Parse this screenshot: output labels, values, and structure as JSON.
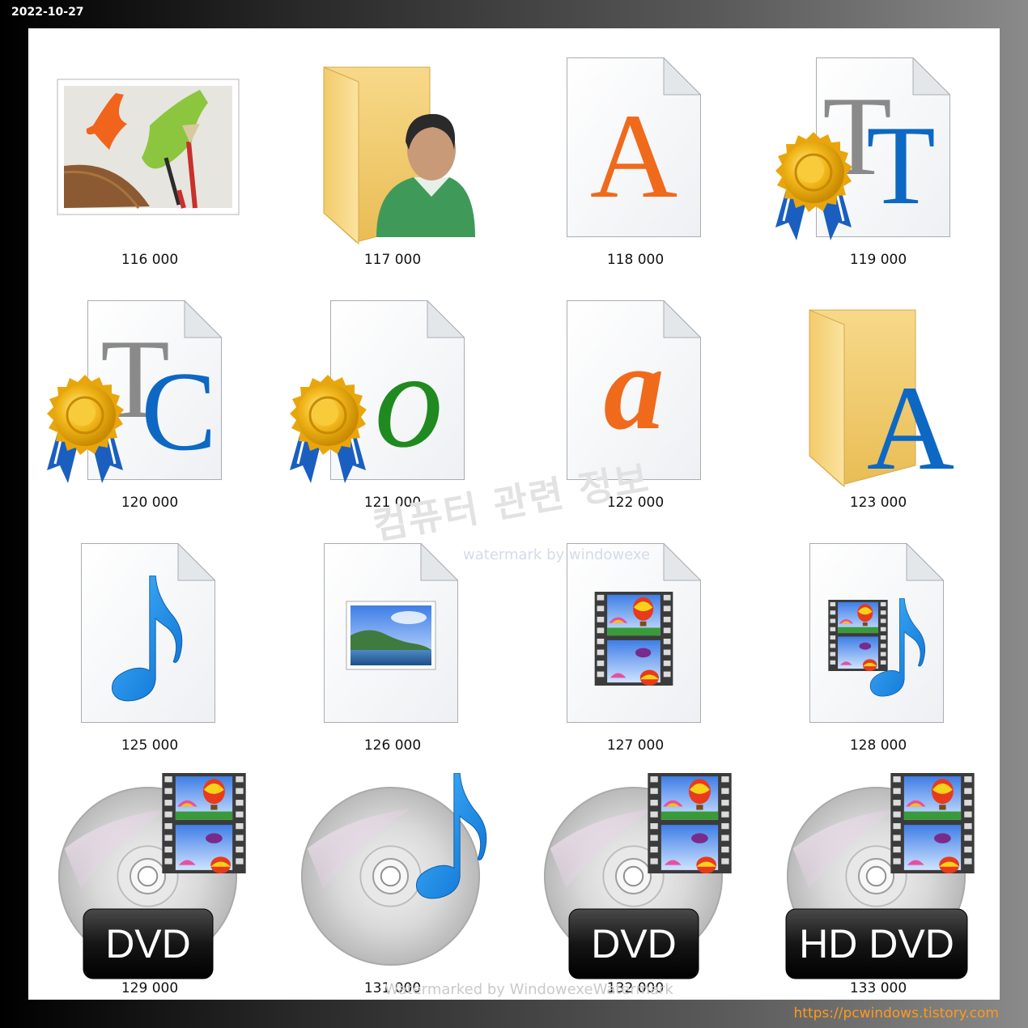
{
  "date_stamp": "2022-10-27",
  "site_url": "https://pcwindows.tistory.com",
  "watermarks": {
    "korean": "컴퓨터 관련 정보",
    "latin": "watermark by windowexe",
    "bottom": "Watermarked by WindowexeWatermark"
  },
  "icons": [
    {
      "label": "116 000",
      "icon": "painting-picture-icon"
    },
    {
      "label": "117 000",
      "icon": "user-folder-icon"
    },
    {
      "label": "118 000",
      "icon": "font-file-a-icon"
    },
    {
      "label": "119 000",
      "icon": "truetype-font-icon"
    },
    {
      "label": "120 000",
      "icon": "truetype-collection-font-icon"
    },
    {
      "label": "121 000",
      "icon": "opentype-font-icon"
    },
    {
      "label": "122 000",
      "icon": "font-file-italic-a-icon"
    },
    {
      "label": "123 000",
      "icon": "fonts-folder-icon"
    },
    {
      "label": "125 000",
      "icon": "music-file-icon"
    },
    {
      "label": "126 000",
      "icon": "image-file-icon"
    },
    {
      "label": "127 000",
      "icon": "video-file-icon"
    },
    {
      "label": "128 000",
      "icon": "media-file-icon"
    },
    {
      "label": "129 000",
      "icon": "dvd-disc-icon",
      "badge": "DVD"
    },
    {
      "label": "131 000",
      "icon": "audio-cd-icon"
    },
    {
      "label": "132 000",
      "icon": "dvd-disc-icon",
      "badge": "DVD"
    },
    {
      "label": "133 000",
      "icon": "hd-dvd-disc-icon",
      "badge": "HD DVD"
    }
  ],
  "colors": {
    "folder": "#f5d37a",
    "font_orange": "#f06a1c",
    "font_blue": "#0c68c3",
    "font_gray": "#8a8a8a",
    "music_blue": "#1c8fe6",
    "url_orange": "#ff9a1a"
  }
}
